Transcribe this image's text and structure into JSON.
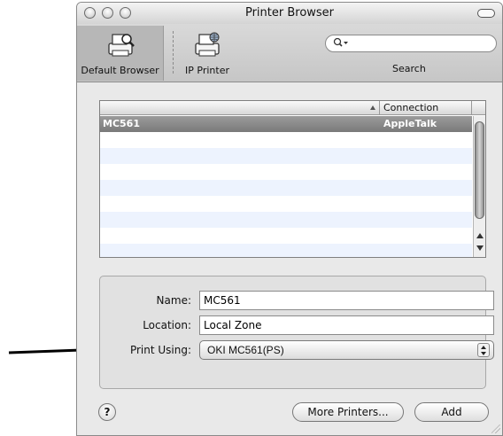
{
  "window": {
    "title": "Printer Browser"
  },
  "toolbar": {
    "default_browser_label": "Default Browser",
    "ip_printer_label": "IP Printer",
    "search_label": "Search",
    "search_value": ""
  },
  "list": {
    "headers": {
      "name": "",
      "connection": "Connection"
    },
    "rows": [
      {
        "name": "MC561",
        "connection": "AppleTalk",
        "selected": true
      }
    ]
  },
  "info": {
    "name_label": "Name:",
    "name_value": "MC561",
    "location_label": "Location:",
    "location_value": "Local Zone",
    "print_using_label": "Print Using:",
    "print_using_value": "OKI MC561(PS)"
  },
  "buttons": {
    "help": "?",
    "more_printers": "More Printers...",
    "add": "Add"
  },
  "icons": {
    "traffic_lights": [
      "close-icon",
      "minimize-icon",
      "zoom-icon"
    ],
    "toolbar_toggle": "toolbar-toggle-icon",
    "default_browser": "printer-browser-icon",
    "ip_printer": "ip-printer-icon",
    "search": "search-icon",
    "annotation": "pointer-arrow-icon"
  },
  "colors": {
    "selection": "#8a8a8a",
    "alt_row": "#edf3fe",
    "window_bg": "#e9e9e9"
  }
}
